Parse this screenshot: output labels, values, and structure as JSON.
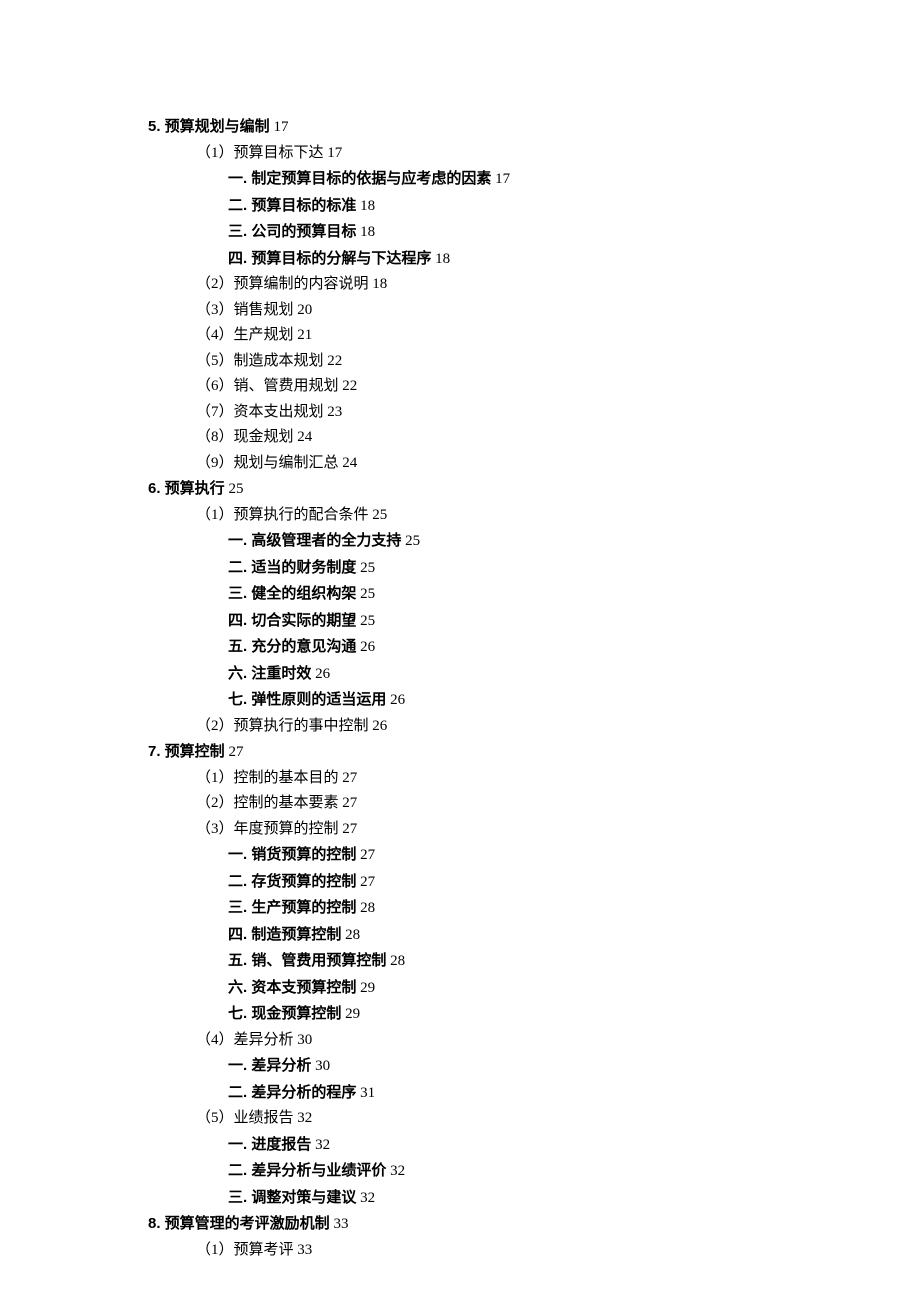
{
  "toc": [
    {
      "lvl": 0,
      "bold": true,
      "text": "5. 预算规划与编制",
      "page": "17"
    },
    {
      "lvl": 1,
      "bold": false,
      "text": "（1）预算目标下达",
      "page": "17"
    },
    {
      "lvl": 2,
      "bold": true,
      "text": "一. 制定预算目标的依据与应考虑的因素",
      "page": "17"
    },
    {
      "lvl": 2,
      "bold": true,
      "text": "二. 预算目标的标准",
      "page": "18"
    },
    {
      "lvl": 2,
      "bold": true,
      "text": "三. 公司的预算目标",
      "page": "18"
    },
    {
      "lvl": 2,
      "bold": true,
      "text": "四. 预算目标的分解与下达程序",
      "page": "18"
    },
    {
      "lvl": 1,
      "bold": false,
      "text": "（2）预算编制的内容说明",
      "page": "18"
    },
    {
      "lvl": 1,
      "bold": false,
      "text": "（3）销售规划",
      "page": "20"
    },
    {
      "lvl": 1,
      "bold": false,
      "text": "（4）生产规划",
      "page": "21"
    },
    {
      "lvl": 1,
      "bold": false,
      "text": "（5）制造成本规划",
      "page": "22"
    },
    {
      "lvl": 1,
      "bold": false,
      "text": "（6）销、管费用规划",
      "page": "22"
    },
    {
      "lvl": 1,
      "bold": false,
      "text": "（7）资本支出规划",
      "page": "23"
    },
    {
      "lvl": 1,
      "bold": false,
      "text": "（8）现金规划",
      "page": "24"
    },
    {
      "lvl": 1,
      "bold": false,
      "text": "（9）规划与编制汇总",
      "page": "24"
    },
    {
      "lvl": 0,
      "bold": true,
      "text": "6. 预算执行",
      "page": "25"
    },
    {
      "lvl": 1,
      "bold": false,
      "text": "（1）预算执行的配合条件",
      "page": "25"
    },
    {
      "lvl": 2,
      "bold": true,
      "text": "一. 高级管理者的全力支持",
      "page": "25"
    },
    {
      "lvl": 2,
      "bold": true,
      "text": "二. 适当的财务制度",
      "page": "25"
    },
    {
      "lvl": 2,
      "bold": true,
      "text": "三. 健全的组织构架",
      "page": "25"
    },
    {
      "lvl": 2,
      "bold": true,
      "text": "四. 切合实际的期望",
      "page": "25"
    },
    {
      "lvl": 2,
      "bold": true,
      "text": "五. 充分的意见沟通",
      "page": "26"
    },
    {
      "lvl": 2,
      "bold": true,
      "text": "六. 注重时效",
      "page": "26"
    },
    {
      "lvl": 2,
      "bold": true,
      "text": "七. 弹性原则的适当运用",
      "page": "26"
    },
    {
      "lvl": 1,
      "bold": false,
      "text": "（2）预算执行的事中控制",
      "page": "26"
    },
    {
      "lvl": 0,
      "bold": true,
      "text": "7. 预算控制",
      "page": "27"
    },
    {
      "lvl": 1,
      "bold": false,
      "text": "（1）控制的基本目的",
      "page": "27"
    },
    {
      "lvl": 1,
      "bold": false,
      "text": "（2）控制的基本要素",
      "page": "27"
    },
    {
      "lvl": 1,
      "bold": false,
      "text": "（3）年度预算的控制",
      "page": "27"
    },
    {
      "lvl": 2,
      "bold": true,
      "text": "一. 销货预算的控制",
      "page": "27"
    },
    {
      "lvl": 2,
      "bold": true,
      "text": "二. 存货预算的控制",
      "page": "27"
    },
    {
      "lvl": 2,
      "bold": true,
      "text": "三. 生产预算的控制",
      "page": "28"
    },
    {
      "lvl": 2,
      "bold": true,
      "text": "四. 制造预算控制",
      "page": "28"
    },
    {
      "lvl": 2,
      "bold": true,
      "text": "五. 销、管费用预算控制",
      "page": "28"
    },
    {
      "lvl": 2,
      "bold": true,
      "text": "六. 资本支预算控制",
      "page": "29"
    },
    {
      "lvl": 2,
      "bold": true,
      "text": "七. 现金预算控制",
      "page": "29"
    },
    {
      "lvl": 1,
      "bold": false,
      "text": "（4）差异分析",
      "page": "30"
    },
    {
      "lvl": 2,
      "bold": true,
      "text": "一. 差异分析",
      "page": "30"
    },
    {
      "lvl": 2,
      "bold": true,
      "text": "二. 差异分析的程序",
      "page": "31"
    },
    {
      "lvl": 1,
      "bold": false,
      "text": "（5）业绩报告",
      "page": "32"
    },
    {
      "lvl": 2,
      "bold": true,
      "text": "一. 进度报告",
      "page": "32"
    },
    {
      "lvl": 2,
      "bold": true,
      "text": "二. 差异分析与业绩评价",
      "page": "32"
    },
    {
      "lvl": 2,
      "bold": true,
      "text": "三. 调整对策与建议",
      "page": "32"
    },
    {
      "lvl": 0,
      "bold": true,
      "text": "8. 预算管理的考评激励机制",
      "page": "33"
    },
    {
      "lvl": 1,
      "bold": false,
      "text": "（1）预算考评",
      "page": "33"
    }
  ]
}
